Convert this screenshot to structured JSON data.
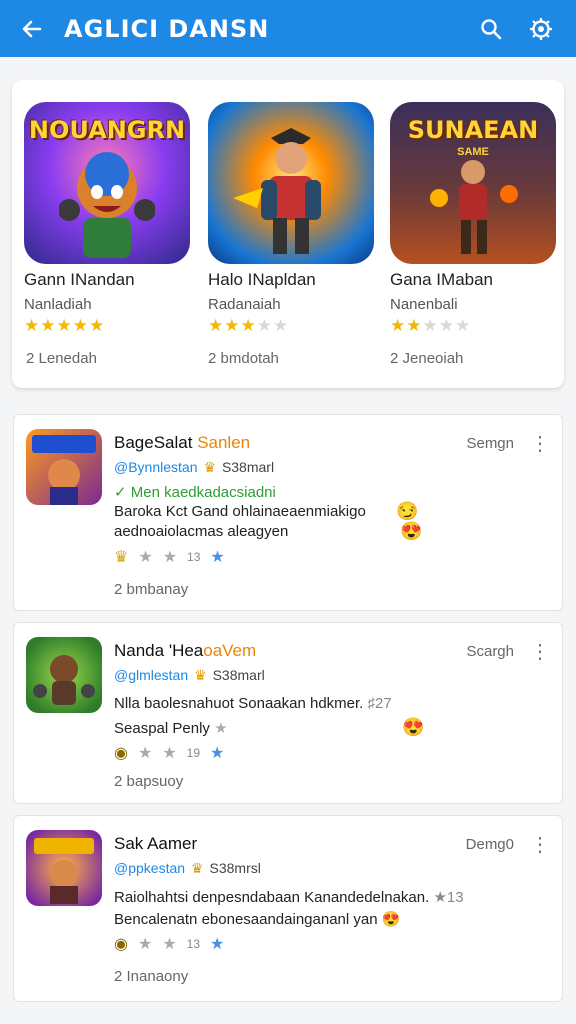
{
  "appbar": {
    "title": "AGLICI DANSN",
    "back_icon": "arrow-left-icon",
    "search_icon": "search-icon",
    "settings_icon": "gear-icon",
    "color": "#1e88e5"
  },
  "featured": [
    {
      "art_title": "NOUANGRN",
      "name": "Gann INandan",
      "subtitle": "Nanladiah",
      "rating": 5,
      "downloads": "2 Lenedah"
    },
    {
      "art_title": "",
      "name": "Halo INapldan",
      "subtitle": "Radanaiah",
      "rating": 3,
      "downloads": "2 bmdotah"
    },
    {
      "art_title": "SUNAEAN",
      "art_sub": "SAME",
      "name": "Gana IMaban",
      "subtitle": "Nanenbali",
      "rating": 2,
      "downloads": "2 Jeneoiah"
    }
  ],
  "reviews": [
    {
      "name": "BageSalat",
      "name_hl": "Sanlen",
      "handle": "@Bynnlestan",
      "count": "S38marl",
      "badge": "Semgn",
      "line1": "Men kaedkadacsiadni",
      "line2": "Baroka Kct  Gand  ohlainaeaenmiakigo",
      "line3": "aednoaiolacmas aleagyen",
      "nums": "13",
      "footer": "2 bmbanay"
    },
    {
      "name": "Nanda 'Hea",
      "name_hl": "oaVem",
      "handle": "@glmlestan",
      "count": "S38marl",
      "badge": "Scargh",
      "line1": "Nlla baolesnahuot Sonaakan hdkmer.",
      "line1_tail": "♯27",
      "line2": "Seaspal Penly",
      "line3": "",
      "nums": "19",
      "footer": "2 bapsuoy"
    },
    {
      "name": "Sak Aamer",
      "name_hl": "",
      "handle": "@ppkestan",
      "count": "S38mrsl",
      "badge": "Demg0",
      "line1": "Raiolhahtsi denpesndabaan Kanandedelnakan.",
      "line1_tail": "★13",
      "line2": "Bencalenatn ebonesaandaingananl yan",
      "line3": "",
      "nums": "13",
      "footer": "2 Inanaony"
    }
  ]
}
